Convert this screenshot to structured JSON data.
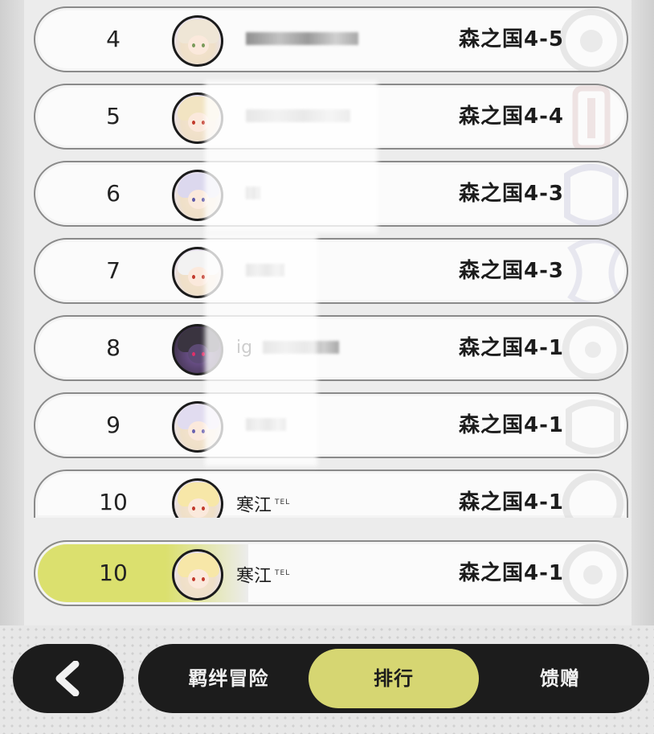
{
  "leaderboard": {
    "rows": [
      {
        "rank": "4",
        "name": "",
        "stage": "森之国4-5",
        "hair": "#efe6d6",
        "accent": "#c8422f"
      },
      {
        "rank": "5",
        "name": "",
        "stage": "森之国4-4",
        "hair": "#f2e4c2",
        "accent": "#c23a2c"
      },
      {
        "rank": "6",
        "name": "",
        "stage": "森之国4-3",
        "hair": "#dcd8ee",
        "accent": "#5f5aa8"
      },
      {
        "rank": "7",
        "name": "",
        "stage": "森之国4-3",
        "hair": "#f2f2f2",
        "accent": "#c23a2c"
      },
      {
        "rank": "8",
        "name": "ig",
        "stage": "森之国4-1",
        "hair": "#3a3440",
        "accent": "#a02c5e"
      },
      {
        "rank": "9",
        "name": "",
        "stage": "森之国4-1",
        "hair": "#e1dcf0",
        "accent": "#6a62b0"
      },
      {
        "rank": "10",
        "name": "寒江",
        "badge": "TEL",
        "stage": "森之国4-1",
        "hair": "#f7e7a8",
        "accent": "#c23a2c"
      }
    ],
    "my_rank": {
      "rank": "10",
      "name": "寒江",
      "badge": "TEL",
      "stage": "森之国4-1"
    }
  },
  "nav": {
    "back_icon": "chevron-left-icon",
    "tabs": [
      {
        "label": "羁绊冒险",
        "active": false
      },
      {
        "label": "排行",
        "active": true
      },
      {
        "label": "馈赠",
        "active": false
      }
    ]
  },
  "colors": {
    "accent": "#d6d672",
    "bar": "#1c1c1c"
  }
}
